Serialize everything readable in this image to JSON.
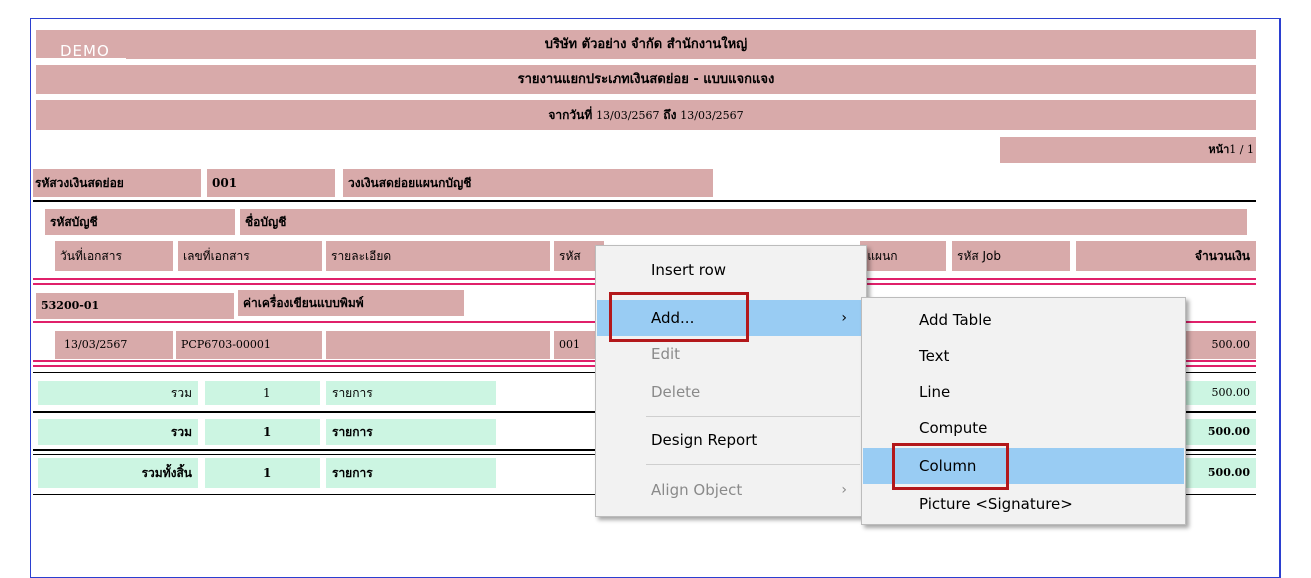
{
  "report": {
    "watermark": "DEMO",
    "company": "บริษัท ตัวอย่าง จำกัด   สำนักงานใหญ่",
    "title": "รายงานแยกประเภทเงินสดย่อย - แบบแจกแจง",
    "date_label": "จากวันที่",
    "date_from": "13/03/2567",
    "date_to_label": "ถึง",
    "date_to": "13/03/2567",
    "page_label": "หน้า",
    "page_value": "1 / 1"
  },
  "fund": {
    "code_label": "รหัสวงเงินสดย่อย",
    "code_value": "001",
    "name": "วงเงินสดย่อยแผนกบัญชี"
  },
  "account_header": {
    "code_label": "รหัสบัญชี",
    "name_label": "ชื่อบัญชี"
  },
  "columns": {
    "doc_date": "วันที่เอกสาร",
    "doc_no": "เลขที่เอกสาร",
    "detail": "รายละเอียด",
    "code_partial": "รหัส",
    "dept_partial": "สแผนก",
    "job": "รหัส Job",
    "amount": "จำนวนเงิน"
  },
  "account": {
    "code": "53200-01",
    "name": "ค่าเครื่องเขียนแบบพิมพ์"
  },
  "row": {
    "date": "13/03/2567",
    "doc_no": "PCP6703-00001",
    "code": "001",
    "amount": "500.00"
  },
  "totals": [
    {
      "label": "รวม",
      "count": "1",
      "unit": "รายการ",
      "amount": "500.00"
    },
    {
      "label": "รวม",
      "count": "1",
      "unit": "รายการ",
      "amount": "500.00"
    },
    {
      "label": "รวมทั้งสิ้น",
      "count": "1",
      "unit": "รายการ",
      "amount": "500.00"
    }
  ],
  "context_menu": {
    "items": [
      {
        "label": "Insert row"
      },
      {
        "label": "Add..."
      },
      {
        "label": "Edit"
      },
      {
        "label": "Delete"
      },
      {
        "label": "Design Report"
      },
      {
        "label": "Align Object"
      }
    ],
    "arrow": "›"
  },
  "submenu": {
    "items": [
      {
        "label": "Add Table"
      },
      {
        "label": "Text"
      },
      {
        "label": "Line"
      },
      {
        "label": "Compute"
      },
      {
        "label": "Column"
      },
      {
        "label": "Picture <Signature>"
      }
    ]
  },
  "colors": {
    "band": "#d8aaaa",
    "total_bg": "#ccf5e2",
    "accent_line": "#e0206a",
    "menu_highlight": "#99ccf3",
    "callout_red": "#b3181b",
    "frame_blue": "#2b3fd0"
  }
}
